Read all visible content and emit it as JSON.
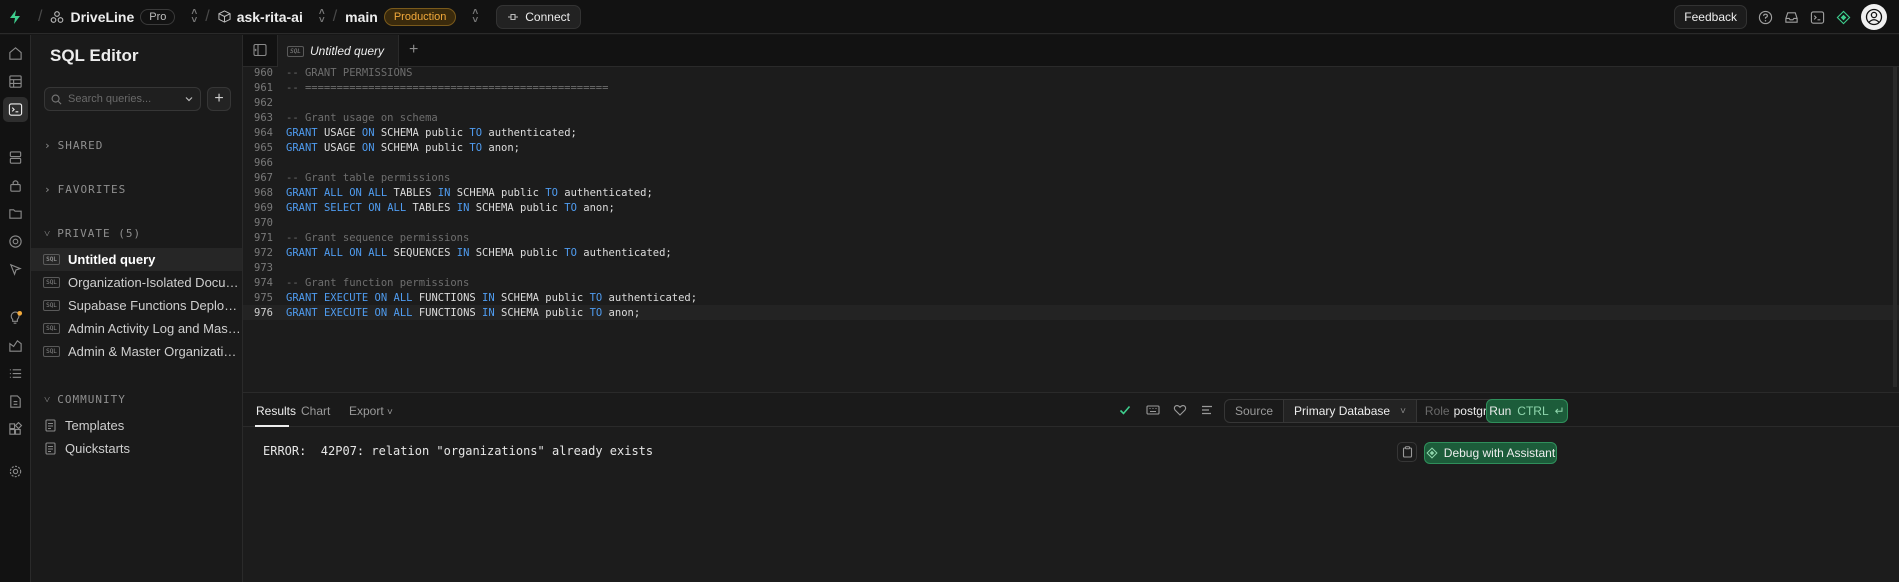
{
  "topbar": {
    "org_name": "DriveLine",
    "org_plan": "Pro",
    "project_name": "ask-rita-ai",
    "branch_name": "main",
    "branch_env": "Production",
    "connect_label": "Connect",
    "feedback_label": "Feedback"
  },
  "sidebar": {
    "title": "SQL Editor",
    "search_placeholder": "Search queries...",
    "sections": {
      "shared": "SHARED",
      "favorites": "FAVORITES",
      "private": "PRIVATE (5)",
      "community": "COMMUNITY"
    },
    "private_items": [
      "Untitled query",
      "Organization-Isolated Docume...",
      "Supabase Functions Deployment",
      "Admin Activity Log and Master...",
      "Admin & Master Organization ..."
    ],
    "community_items": [
      "Templates",
      "Quickstarts"
    ],
    "sql_tag": "SQL"
  },
  "editor": {
    "tab_label": "Untitled query",
    "lines": [
      {
        "n": "960",
        "text": "-- GRANT PERMISSIONS"
      },
      {
        "n": "961",
        "text": "-- ================================================"
      },
      {
        "n": "962",
        "text": ""
      },
      {
        "n": "963",
        "text": "-- Grant usage on schema"
      },
      {
        "n": "964",
        "text": "GRANT USAGE ON SCHEMA public TO authenticated;"
      },
      {
        "n": "965",
        "text": "GRANT USAGE ON SCHEMA public TO anon;"
      },
      {
        "n": "966",
        "text": ""
      },
      {
        "n": "967",
        "text": "-- Grant table permissions"
      },
      {
        "n": "968",
        "text": "GRANT ALL ON ALL TABLES IN SCHEMA public TO authenticated;"
      },
      {
        "n": "969",
        "text": "GRANT SELECT ON ALL TABLES IN SCHEMA public TO anon;"
      },
      {
        "n": "970",
        "text": ""
      },
      {
        "n": "971",
        "text": "-- Grant sequence permissions"
      },
      {
        "n": "972",
        "text": "GRANT ALL ON ALL SEQUENCES IN SCHEMA public TO authenticated;"
      },
      {
        "n": "973",
        "text": ""
      },
      {
        "n": "974",
        "text": "-- Grant function permissions"
      },
      {
        "n": "975",
        "text": "GRANT EXECUTE ON ALL FUNCTIONS IN SCHEMA public TO authenticated;"
      },
      {
        "n": "976",
        "text": "GRANT EXECUTE ON ALL FUNCTIONS IN SCHEMA public TO anon;"
      }
    ],
    "current_line": "976"
  },
  "results": {
    "tabs": {
      "results": "Results",
      "chart": "Chart",
      "export": "Export"
    },
    "source_label": "Source",
    "database": "Primary Database",
    "role_label": "Role",
    "role_value": "postgres",
    "run_label": "Run",
    "run_shortcut": "CTRL",
    "error_text": "ERROR:  42P07: relation \"organizations\" already exists",
    "debug_label": "Debug with Assistant"
  },
  "colors": {
    "accent_green": "#3ecf8e",
    "keyword_blue": "#4f9cf0",
    "production_orange": "#f2a93b"
  }
}
